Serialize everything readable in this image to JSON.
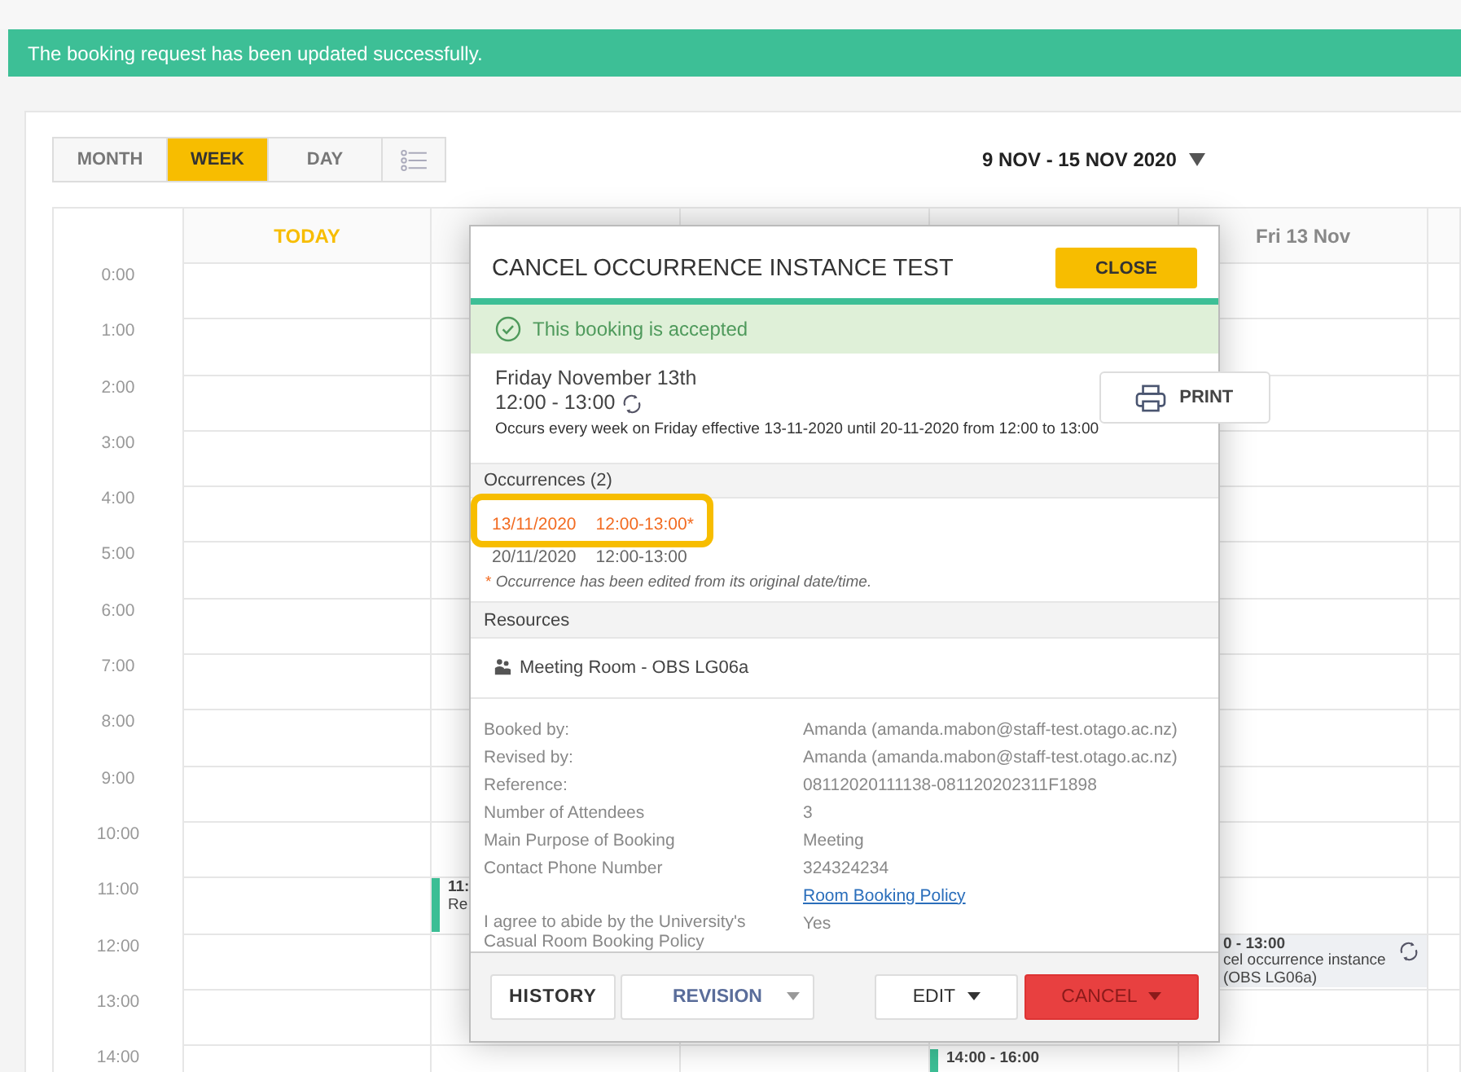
{
  "banner": {
    "message": "The booking request has been updated successfully."
  },
  "view_tabs": [
    {
      "label": "MONTH",
      "selected": false
    },
    {
      "label": "WEEK",
      "selected": true
    },
    {
      "label": "DAY",
      "selected": false
    }
  ],
  "date_range": {
    "label": "9 NOV - 15 NOV 2020"
  },
  "day_headers": [
    {
      "label": "TODAY",
      "today": true
    },
    {
      "label": "Fri 13 Nov",
      "today": false
    }
  ],
  "hours": [
    "0:00",
    "1:00",
    "2:00",
    "3:00",
    "4:00",
    "5:00",
    "6:00",
    "7:00",
    "8:00",
    "9:00",
    "10:00",
    "11:00",
    "12:00",
    "13:00",
    "14:00"
  ],
  "events": [
    {
      "kind": "accepted",
      "lines": [
        "11:",
        "Re"
      ]
    },
    {
      "kind": "pending",
      "lines": [
        "0 - 13:00",
        "cel occurrence instance",
        "(OBS LG06a)"
      ],
      "recurring": true
    },
    {
      "kind": "accepted",
      "lines": [
        "14:00 - 16:00"
      ]
    }
  ],
  "dialog": {
    "title": "CANCEL OCCURRENCE INSTANCE TEST",
    "close_label": "CLOSE",
    "status": "This booking is accepted",
    "date": "Friday November 13th",
    "time": "12:00 - 13:00",
    "recurring": true,
    "recurrence_text": "Occurs every week on Friday effective 13-11-2020 until 20-11-2020 from 12:00 to 13:00",
    "print_label": "PRINT",
    "occurrences_header": "Occurrences (2)",
    "occurrences": [
      {
        "date": "13/11/2020",
        "time": "12:00-13:00*",
        "edited": true
      },
      {
        "date": "20/11/2020",
        "time": "12:00-13:00",
        "edited": false
      }
    ],
    "note_mark": "*",
    "note": "Occurrence has been edited from its original date/time.",
    "resources_header": "Resources",
    "resource": "Meeting Room - OBS LG06a",
    "details": [
      {
        "label": "Booked by:",
        "value": "Amanda (amanda.mabon@staff-test.otago.ac.nz)",
        "kind": "text"
      },
      {
        "label": "Revised by:",
        "value": "Amanda (amanda.mabon@staff-test.otago.ac.nz)",
        "kind": "text"
      },
      {
        "label": "Reference:",
        "value": "08112020111138-081120202311F1898",
        "kind": "text"
      },
      {
        "label": "Number of Attendees",
        "value": "3",
        "kind": "text"
      },
      {
        "label": "Main Purpose of Booking",
        "value": "Meeting",
        "kind": "text"
      },
      {
        "label": "Contact Phone Number",
        "value": "324324234",
        "kind": "text"
      },
      {
        "value": "Room Booking Policy",
        "kind": "link"
      },
      {
        "label": "I agree to abide by the University's Casual Room Booking Policy",
        "value": "Yes",
        "kind": "text"
      }
    ],
    "history_label": "HISTORY",
    "revision_label": "REVISION",
    "edit_label": "EDIT",
    "cancel_label": "CANCEL"
  }
}
